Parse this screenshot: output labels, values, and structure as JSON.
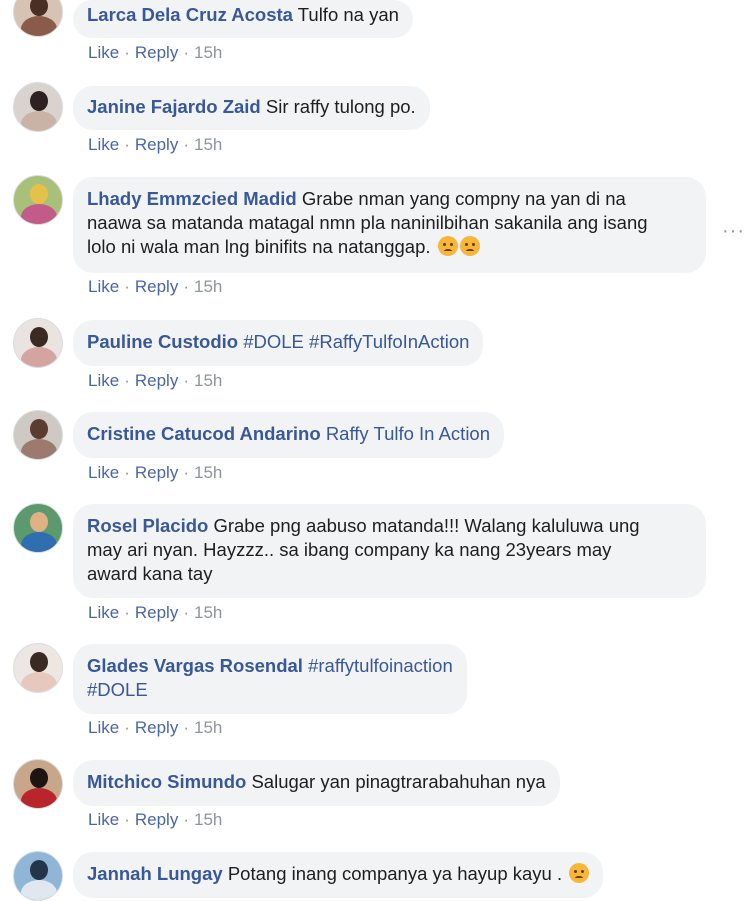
{
  "actions": {
    "like": "Like",
    "reply": "Reply",
    "separator": "·"
  },
  "colors": {
    "author": "#385898",
    "bubble": "#f2f3f5",
    "meta": "#90949c",
    "emoji": "#f5b63a"
  },
  "comments": [
    {
      "author": "Larca Dela Cruz Acosta",
      "text": "Tulfo na yan",
      "time": "15h"
    },
    {
      "author": "Janine Fajardo Zaid",
      "text": "Sir raffy tulong po.",
      "time": "15h"
    },
    {
      "author": "Lhady Emmzcied Madid",
      "text_line1": "Grabe nman yang compny na yan di na",
      "text_line2": "naawa sa matanda matagal nmn pla naninilbihan sakanila ang isang",
      "text_line3": "lolo ni wala man lng binifits na natanggap.",
      "emoji": "frowning-face-icon",
      "time": "15h"
    },
    {
      "author": "Pauline Custodio",
      "tags": "#DOLE #RaffyTulfoInAction",
      "time": "15h"
    },
    {
      "author": "Cristine Catucod Andarino",
      "tags": "Raffy Tulfo In Action",
      "time": "15h"
    },
    {
      "author": "Rosel Placido",
      "text_line1": "Grabe png aabuso matanda!!! Walang kaluluwa ung",
      "text_line2": "may ari nyan. Hayzzz.. sa ibang company ka nang 23years may",
      "text_line3": "award kana tay",
      "time": "15h"
    },
    {
      "author": "Glades Vargas Rosendal",
      "tags_line1": "#raffytulfoinaction",
      "tags_line2": "#DOLE",
      "time": "15h"
    },
    {
      "author": "Mitchico Simundo",
      "text": "Salugar yan pinagtrarabahuhan nya",
      "time": "15h"
    },
    {
      "author": "Jannah Lungay",
      "text": "Potang inang companya ya hayup kayu .",
      "emoji": "frowning-face-icon"
    }
  ],
  "more_options": "···"
}
